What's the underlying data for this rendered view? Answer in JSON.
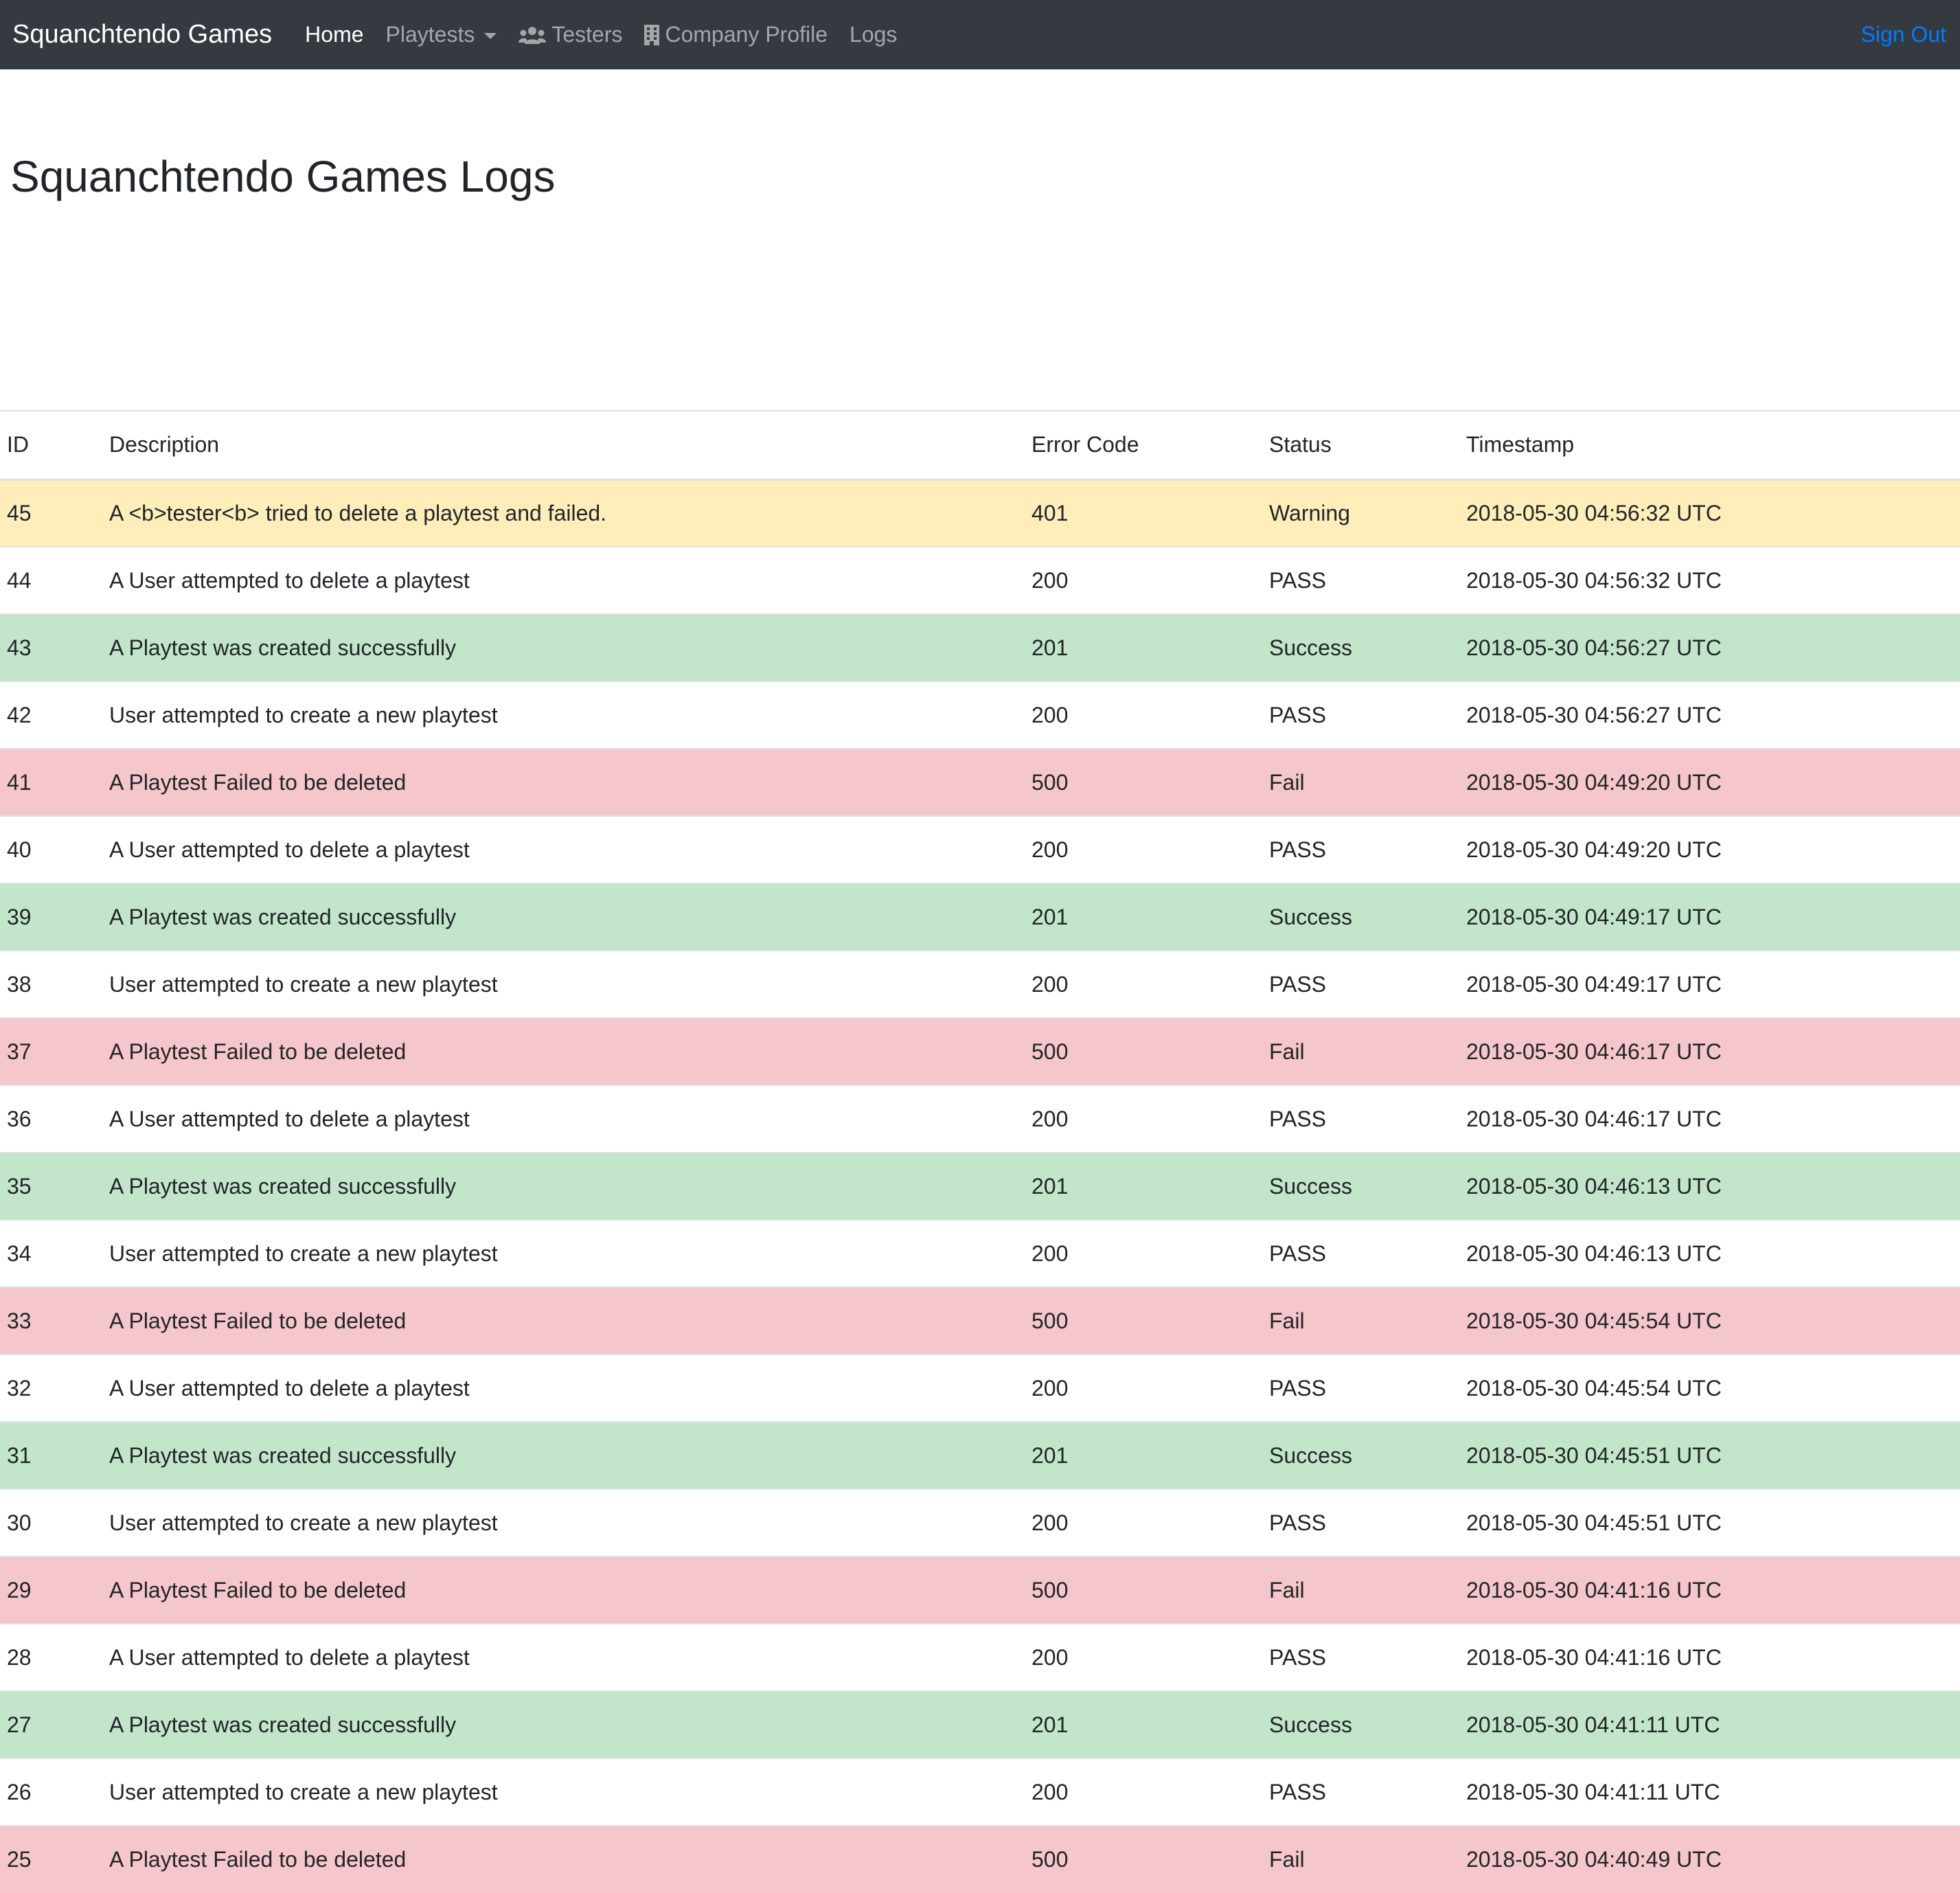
{
  "navbar": {
    "brand": "Squanchtendo Games",
    "items": [
      {
        "label": "Home",
        "active": true,
        "icon": null
      },
      {
        "label": "Playtests",
        "active": false,
        "icon": "chevron-down-icon"
      },
      {
        "label": "Testers",
        "active": false,
        "icon": "users-icon"
      },
      {
        "label": "Company Profile",
        "active": false,
        "icon": "building-icon"
      },
      {
        "label": "Logs",
        "active": false,
        "icon": null
      }
    ],
    "sign_out": "Sign Out",
    "colors": {
      "background": "#343a40",
      "link": "#007bff"
    }
  },
  "page": {
    "title": "Squanchtendo Games Logs"
  },
  "table": {
    "headers": [
      "ID",
      "Description",
      "Error Code",
      "Status",
      "Timestamp"
    ],
    "rows": [
      {
        "id": "45",
        "description": "A <b>tester<b> tried to delete a playtest and failed.",
        "code": "401",
        "status": "Warning",
        "timestamp": "2018-05-30 04:56:32 UTC",
        "variant": "warning"
      },
      {
        "id": "44",
        "description": "A User attempted to delete a playtest",
        "code": "200",
        "status": "PASS",
        "timestamp": "2018-05-30 04:56:32 UTC",
        "variant": "default"
      },
      {
        "id": "43",
        "description": "A Playtest was created successfully",
        "code": "201",
        "status": "Success",
        "timestamp": "2018-05-30 04:56:27 UTC",
        "variant": "success"
      },
      {
        "id": "42",
        "description": "User attempted to create a new playtest",
        "code": "200",
        "status": "PASS",
        "timestamp": "2018-05-30 04:56:27 UTC",
        "variant": "default"
      },
      {
        "id": "41",
        "description": "A Playtest Failed to be deleted",
        "code": "500",
        "status": "Fail",
        "timestamp": "2018-05-30 04:49:20 UTC",
        "variant": "danger"
      },
      {
        "id": "40",
        "description": "A User attempted to delete a playtest",
        "code": "200",
        "status": "PASS",
        "timestamp": "2018-05-30 04:49:20 UTC",
        "variant": "default"
      },
      {
        "id": "39",
        "description": "A Playtest was created successfully",
        "code": "201",
        "status": "Success",
        "timestamp": "2018-05-30 04:49:17 UTC",
        "variant": "success"
      },
      {
        "id": "38",
        "description": "User attempted to create a new playtest",
        "code": "200",
        "status": "PASS",
        "timestamp": "2018-05-30 04:49:17 UTC",
        "variant": "default"
      },
      {
        "id": "37",
        "description": "A Playtest Failed to be deleted",
        "code": "500",
        "status": "Fail",
        "timestamp": "2018-05-30 04:46:17 UTC",
        "variant": "danger"
      },
      {
        "id": "36",
        "description": "A User attempted to delete a playtest",
        "code": "200",
        "status": "PASS",
        "timestamp": "2018-05-30 04:46:17 UTC",
        "variant": "default"
      },
      {
        "id": "35",
        "description": "A Playtest was created successfully",
        "code": "201",
        "status": "Success",
        "timestamp": "2018-05-30 04:46:13 UTC",
        "variant": "success"
      },
      {
        "id": "34",
        "description": "User attempted to create a new playtest",
        "code": "200",
        "status": "PASS",
        "timestamp": "2018-05-30 04:46:13 UTC",
        "variant": "default"
      },
      {
        "id": "33",
        "description": "A Playtest Failed to be deleted",
        "code": "500",
        "status": "Fail",
        "timestamp": "2018-05-30 04:45:54 UTC",
        "variant": "danger"
      },
      {
        "id": "32",
        "description": "A User attempted to delete a playtest",
        "code": "200",
        "status": "PASS",
        "timestamp": "2018-05-30 04:45:54 UTC",
        "variant": "default"
      },
      {
        "id": "31",
        "description": "A Playtest was created successfully",
        "code": "201",
        "status": "Success",
        "timestamp": "2018-05-30 04:45:51 UTC",
        "variant": "success"
      },
      {
        "id": "30",
        "description": "User attempted to create a new playtest",
        "code": "200",
        "status": "PASS",
        "timestamp": "2018-05-30 04:45:51 UTC",
        "variant": "default"
      },
      {
        "id": "29",
        "description": "A Playtest Failed to be deleted",
        "code": "500",
        "status": "Fail",
        "timestamp": "2018-05-30 04:41:16 UTC",
        "variant": "danger"
      },
      {
        "id": "28",
        "description": "A User attempted to delete a playtest",
        "code": "200",
        "status": "PASS",
        "timestamp": "2018-05-30 04:41:16 UTC",
        "variant": "default"
      },
      {
        "id": "27",
        "description": "A Playtest was created successfully",
        "code": "201",
        "status": "Success",
        "timestamp": "2018-05-30 04:41:11 UTC",
        "variant": "success"
      },
      {
        "id": "26",
        "description": "User attempted to create a new playtest",
        "code": "200",
        "status": "PASS",
        "timestamp": "2018-05-30 04:41:11 UTC",
        "variant": "default"
      },
      {
        "id": "25",
        "description": "A Playtest Failed to be deleted",
        "code": "500",
        "status": "Fail",
        "timestamp": "2018-05-30 04:40:49 UTC",
        "variant": "danger"
      }
    ],
    "row_colors": {
      "warning": "#ffeeba",
      "success": "#c3e6cb",
      "danger": "#f5c6cb",
      "default": "#ffffff"
    }
  }
}
